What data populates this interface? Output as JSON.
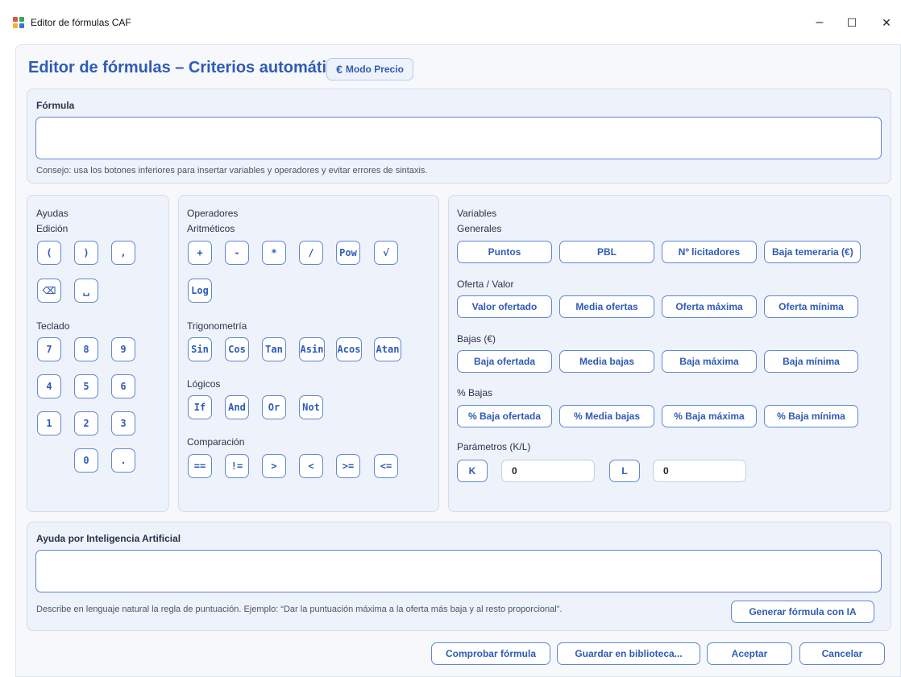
{
  "window": {
    "title": "Editor de fórmulas CAF",
    "minimize": "–",
    "maximize": "☐",
    "close": "✕"
  },
  "header": {
    "title": "Editor de fórmulas – Criterios automáticos",
    "mode_icon": "€",
    "mode_label": "Modo Precio"
  },
  "formula": {
    "label": "Fórmula",
    "value": "",
    "hint": "Consejo: usa los botones inferiores para insertar variables y operadores y evitar errores de sintaxis."
  },
  "ayudas": {
    "title": "Ayudas",
    "edicion_label": "Edición",
    "edicion": [
      "(",
      ")",
      ",",
      "⌫",
      "␣"
    ],
    "teclado_label": "Teclado",
    "teclado": [
      "7",
      "8",
      "9",
      "4",
      "5",
      "6",
      "1",
      "2",
      "3",
      "0",
      "."
    ]
  },
  "operadores": {
    "title": "Operadores",
    "aritmeticos_label": "Aritméticos",
    "aritmeticos": [
      "+",
      "-",
      "*",
      "/",
      "Pow",
      "√",
      "Log"
    ],
    "trigonometria_label": "Trigonometría",
    "trigonometria": [
      "Sin",
      "Cos",
      "Tan",
      "Asin",
      "Acos",
      "Atan"
    ],
    "logicos_label": "Lógicos",
    "logicos": [
      "If",
      "And",
      "Or",
      "Not"
    ],
    "comparacion_label": "Comparación",
    "comparacion": [
      "==",
      "!=",
      ">",
      "<",
      ">=",
      "<="
    ]
  },
  "variables": {
    "title": "Variables",
    "generales_label": "Generales",
    "generales": [
      "Puntos",
      "PBL",
      "Nº licitadores",
      "Baja temeraria (€)"
    ],
    "oferta_label": "Oferta / Valor",
    "oferta": [
      "Valor ofertado",
      "Media ofertas",
      "Oferta máxima",
      "Oferta mínima"
    ],
    "bajas_label": "Bajas (€)",
    "bajas": [
      "Baja ofertada",
      "Media bajas",
      "Baja máxima",
      "Baja mínima"
    ],
    "pct_label": "% Bajas",
    "pct": [
      "% Baja ofertada",
      "% Media bajas",
      "% Baja máxima",
      "% Baja mínima"
    ],
    "params_label": "Parámetros (K/L)",
    "k_label": "K",
    "k_value": "0",
    "l_label": "L",
    "l_value": "0"
  },
  "ia": {
    "label": "Ayuda por Inteligencia Artificial",
    "value": "",
    "hint": "Describe en lenguaje natural la regla de puntuación. Ejemplo: “Dar la puntuación máxima a la oferta más baja y al resto proporcional”.",
    "generate": "Generar fórmula con IA"
  },
  "actions": {
    "check": "Comprobar fórmula",
    "save": "Guardar en biblioteca...",
    "accept": "Aceptar",
    "cancel": "Cancelar"
  },
  "colors": {
    "accent": "#2f5bb5",
    "border": "#5f87d4",
    "panel": "#eef2fa"
  }
}
